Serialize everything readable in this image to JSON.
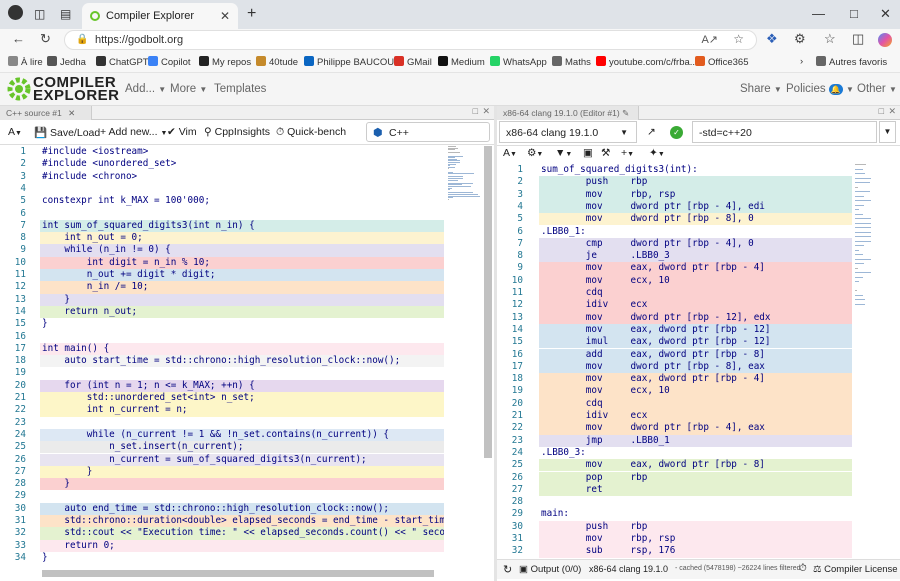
{
  "browser": {
    "tab_title": "Compiler Explorer",
    "url": "https://godbolt.org",
    "bookmarks": [
      {
        "label": "À lire",
        "color": "#888888"
      },
      {
        "label": "Jedha",
        "color": "#555555"
      },
      {
        "label": "ChatGPT",
        "color": "#333333"
      },
      {
        "label": "Copilot",
        "color": "#3b82f6"
      },
      {
        "label": "My repos",
        "color": "#222222"
      },
      {
        "label": "40tude",
        "color": "#c58a2b"
      },
      {
        "label": "Philippe BAUCOUR",
        "color": "#0a66c2"
      },
      {
        "label": "GMail",
        "color": "#d93025"
      },
      {
        "label": "Medium",
        "color": "#111111"
      },
      {
        "label": "WhatsApp",
        "color": "#25d366"
      },
      {
        "label": "Maths",
        "color": "#666666"
      },
      {
        "label": "youtube.com/c/frba...",
        "color": "#ff0000"
      },
      {
        "label": "Office365",
        "color": "#e25b1e"
      },
      {
        "label": "Autres favoris",
        "color": "#666666"
      }
    ]
  },
  "ce": {
    "logo_line1": "COMPILER",
    "logo_line2": "EXPLORER",
    "menu_add": "Add...",
    "menu_more": "More",
    "menu_templates": "Templates",
    "menu_share": "Share",
    "menu_policies": "Policies",
    "menu_other": "Other",
    "accent": "#67c52a"
  },
  "editor": {
    "tab": "C++ source #1",
    "save_load": "Save/Load",
    "add_new": "+ Add new...",
    "vim": "Vim",
    "cppinsights": "CppInsights",
    "quickbench": "Quick-bench",
    "language": "C++",
    "lines": [
      {
        "n": "1",
        "t": "#include <iostream>",
        "bg": ""
      },
      {
        "n": "2",
        "t": "#include <unordered_set>",
        "bg": ""
      },
      {
        "n": "3",
        "t": "#include <chrono>",
        "bg": ""
      },
      {
        "n": "4",
        "t": "",
        "bg": ""
      },
      {
        "n": "5",
        "t": "constexpr int k_MAX = 100'000;",
        "bg": ""
      },
      {
        "n": "6",
        "t": "",
        "bg": ""
      },
      {
        "n": "7",
        "t": "int sum_of_squared_digits3(int n_in) {",
        "bg": "#d4ede8"
      },
      {
        "n": "8",
        "t": "    int n_out = 0;",
        "bg": "#fdf3d0"
      },
      {
        "n": "9",
        "t": "    while (n_in != 0) {",
        "bg": "#e3dff0"
      },
      {
        "n": "10",
        "t": "        int digit = n_in % 10;",
        "bg": "#fbd0d0"
      },
      {
        "n": "11",
        "t": "        n_out += digit * digit;",
        "bg": "#d3e4f0"
      },
      {
        "n": "12",
        "t": "        n_in /= 10;",
        "bg": "#fde3c8"
      },
      {
        "n": "13",
        "t": "    }",
        "bg": "#e3dff0"
      },
      {
        "n": "14",
        "t": "    return n_out;",
        "bg": "#e4f2d0"
      },
      {
        "n": "15",
        "t": "}",
        "bg": ""
      },
      {
        "n": "16",
        "t": "",
        "bg": ""
      },
      {
        "n": "17",
        "t": "int main() {",
        "bg": "#fde8ee"
      },
      {
        "n": "18",
        "t": "    auto start_time = std::chrono::high_resolution_clock::now();",
        "bg": "#f3f3f3"
      },
      {
        "n": "19",
        "t": "",
        "bg": ""
      },
      {
        "n": "20",
        "t": "    for (int n = 1; n <= k_MAX; ++n) {",
        "bg": "#e6d8ee"
      },
      {
        "n": "21",
        "t": "        std::unordered_set<int> n_set;",
        "bg": "#fdf6c8"
      },
      {
        "n": "22",
        "t": "        int n_current = n;",
        "bg": "#fdf6c8"
      },
      {
        "n": "23",
        "t": "",
        "bg": ""
      },
      {
        "n": "24",
        "t": "        while (n_current != 1 && !n_set.contains(n_current)) {",
        "bg": "#dde8f4"
      },
      {
        "n": "25",
        "t": "            n_set.insert(n_current);",
        "bg": "#ebebeb"
      },
      {
        "n": "26",
        "t": "            n_current = sum_of_squared_digits3(n_current);",
        "bg": "#e8e4f0"
      },
      {
        "n": "27",
        "t": "        }",
        "bg": "#fdf6c8"
      },
      {
        "n": "28",
        "t": "    }",
        "bg": "#fbd0d0"
      },
      {
        "n": "29",
        "t": "",
        "bg": ""
      },
      {
        "n": "30",
        "t": "    auto end_time = std::chrono::high_resolution_clock::now();",
        "bg": "#d3e4f0"
      },
      {
        "n": "31",
        "t": "    std::chrono::duration<double> elapsed_seconds = end_time - start_time;",
        "bg": "#fde3c8"
      },
      {
        "n": "32",
        "t": "    std::cout << \"Execution time: \" << elapsed_seconds.count() << \" seconds\\n\";",
        "bg": "#e4f2d0"
      },
      {
        "n": "33",
        "t": "    return 0;",
        "bg": "#fde8ee"
      },
      {
        "n": "34",
        "t": "}",
        "bg": ""
      }
    ]
  },
  "compiler": {
    "tab": "x86-64 clang 19.1.0 (Editor #1)",
    "name": "x86-64 clang 19.1.0",
    "options": "-std=c++20",
    "output_label": "Output (0/0)",
    "status_compiler": "x86-64 clang 19.1.0",
    "cached_info": "- cached (5478198) ~26224 lines filtered",
    "license": "Compiler License",
    "lines": [
      {
        "n": "1",
        "t": "sum_of_squared_digits3(int):",
        "bg": ""
      },
      {
        "n": "2",
        "t": "        push    rbp",
        "bg": "#d4ede8"
      },
      {
        "n": "3",
        "t": "        mov     rbp, rsp",
        "bg": "#d4ede8"
      },
      {
        "n": "4",
        "t": "        mov     dword ptr [rbp - 4], edi",
        "bg": "#d4ede8"
      },
      {
        "n": "5",
        "t": "        mov     dword ptr [rbp - 8], 0",
        "bg": "#fdf3d0"
      },
      {
        "n": "6",
        "t": ".LBB0_1:",
        "bg": ""
      },
      {
        "n": "7",
        "t": "        cmp     dword ptr [rbp - 4], 0",
        "bg": "#e3dff0"
      },
      {
        "n": "8",
        "t": "        je      .LBB0_3",
        "bg": "#e3dff0"
      },
      {
        "n": "9",
        "t": "        mov     eax, dword ptr [rbp - 4]",
        "bg": "#fbd0d0"
      },
      {
        "n": "10",
        "t": "        mov     ecx, 10",
        "bg": "#fbd0d0"
      },
      {
        "n": "11",
        "t": "        cdq",
        "bg": "#fbd0d0"
      },
      {
        "n": "12",
        "t": "        idiv    ecx",
        "bg": "#fbd0d0"
      },
      {
        "n": "13",
        "t": "        mov     dword ptr [rbp - 12], edx",
        "bg": "#fbd0d0"
      },
      {
        "n": "14",
        "t": "        mov     eax, dword ptr [rbp - 12]",
        "bg": "#d3e4f0"
      },
      {
        "n": "15",
        "t": "        imul    eax, dword ptr [rbp - 12]",
        "bg": "#d3e4f0"
      },
      {
        "n": "16",
        "t": "        add     eax, dword ptr [rbp - 8]",
        "bg": "#d3e4f0"
      },
      {
        "n": "17",
        "t": "        mov     dword ptr [rbp - 8], eax",
        "bg": "#d3e4f0"
      },
      {
        "n": "18",
        "t": "        mov     eax, dword ptr [rbp - 4]",
        "bg": "#fde3c8"
      },
      {
        "n": "19",
        "t": "        mov     ecx, 10",
        "bg": "#fde3c8"
      },
      {
        "n": "20",
        "t": "        cdq",
        "bg": "#fde3c8"
      },
      {
        "n": "21",
        "t": "        idiv    ecx",
        "bg": "#fde3c8"
      },
      {
        "n": "22",
        "t": "        mov     dword ptr [rbp - 4], eax",
        "bg": "#fde3c8"
      },
      {
        "n": "23",
        "t": "        jmp     .LBB0_1",
        "bg": "#e3dff0"
      },
      {
        "n": "24",
        "t": ".LBB0_3:",
        "bg": ""
      },
      {
        "n": "25",
        "t": "        mov     eax, dword ptr [rbp - 8]",
        "bg": "#e4f2d0"
      },
      {
        "n": "26",
        "t": "        pop     rbp",
        "bg": "#e4f2d0"
      },
      {
        "n": "27",
        "t": "        ret",
        "bg": "#e4f2d0"
      },
      {
        "n": "28",
        "t": "",
        "bg": ""
      },
      {
        "n": "29",
        "t": "main:",
        "bg": ""
      },
      {
        "n": "30",
        "t": "        push    rbp",
        "bg": "#fde8ee"
      },
      {
        "n": "31",
        "t": "        mov     rbp, rsp",
        "bg": "#fde8ee"
      },
      {
        "n": "32",
        "t": "        sub     rsp, 176",
        "bg": "#fde8ee"
      }
    ]
  }
}
